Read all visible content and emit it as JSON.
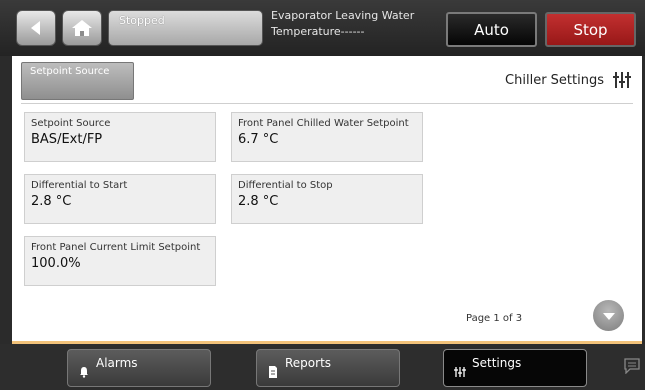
{
  "header": {
    "status_text": "Stopped",
    "evaporator_label_line1": "Evaporator Leaving Water",
    "evaporator_label_line2": "Temperature------",
    "auto_label": "Auto",
    "stop_label": "Stop"
  },
  "main": {
    "tab_source_label": "Setpoint Source",
    "title": "Chiller Settings",
    "cards": [
      {
        "label": "Setpoint Source",
        "value": "BAS/Ext/FP"
      },
      {
        "label": "Front Panel Chilled Water Setpoint",
        "value": "6.7 °C"
      },
      {
        "label": "Differential to Start",
        "value": "2.8 °C"
      },
      {
        "label": "Differential to Stop",
        "value": "2.8 °C"
      },
      {
        "label": "Front Panel Current Limit Setpoint",
        "value": "100.0%"
      }
    ],
    "page_text": "Page 1 of 3"
  },
  "nav": {
    "alarms_label": "Alarms",
    "reports_label": "Reports",
    "settings_label": "Settings"
  },
  "colors": {
    "stop_red": "#b82424",
    "accent_orange": "#f2c27a"
  }
}
